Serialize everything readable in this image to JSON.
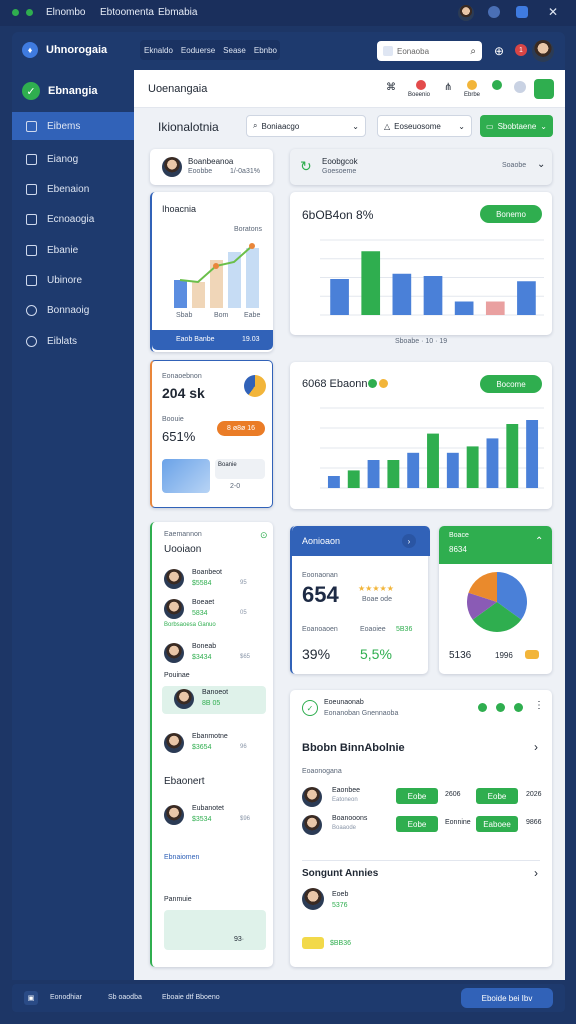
{
  "os_bar": {
    "items": [
      "Elnombo",
      "Ebtoomenta",
      "Ebmabia"
    ]
  },
  "header": {
    "app_name": "Uhnorogaia",
    "nav": [
      "Eknaldo",
      "Eoduerse",
      "Sease",
      "Ebnbo"
    ],
    "search_placeholder": "Eonaoba",
    "notification_count": "1"
  },
  "sidebar": {
    "brand": "Ebnangia",
    "items": [
      {
        "label": "Eibems",
        "icon": "grid-icon",
        "active": true
      },
      {
        "label": "Eianog",
        "icon": "square-icon"
      },
      {
        "label": "Ebenaion",
        "icon": "document-icon"
      },
      {
        "label": "Ecnoaogia",
        "icon": "folder-icon"
      },
      {
        "label": "Ebanie",
        "icon": "edit-icon"
      },
      {
        "label": "Ubinore",
        "icon": "chart-icon"
      },
      {
        "label": "Bonnaoig",
        "icon": "clock-icon"
      },
      {
        "label": "Eiblats",
        "icon": "settings-icon"
      }
    ]
  },
  "top_toolbar": {
    "title": "Uoenangaia",
    "badges": [
      "Boeenio",
      "Ebrbe"
    ]
  },
  "filter_row": {
    "title": "Ikionalotnia",
    "select1": "Boniaacgo",
    "select2": "Eoseuosome",
    "action": "Sbobtaene"
  },
  "user_card": {
    "name": "Boanbeanoa",
    "sub": "Eoobbe",
    "meta": "1/-0a31%"
  },
  "hero_card": {
    "title": "Eoobgcok",
    "sub": "Goesoeme",
    "meta": "Soaobe"
  },
  "mini_chart": {
    "title": "Ihoacnia",
    "legend": "Boratons",
    "footer_label": "Eaob Banbe",
    "footer_value": "19.03",
    "x_labels": [
      "Sbab",
      "Bom",
      "Eabe"
    ]
  },
  "chart1": {
    "title": "6bOB4on 8%",
    "action": "Bonemo",
    "footer": "Sboabe · 10 · 19"
  },
  "chart2": {
    "title": "6068 Ebaonn",
    "action": "Bocome"
  },
  "stat_card": {
    "sub": "Eonaoebnon",
    "value": "204 sk",
    "label": "Boouie",
    "percent": "651%",
    "pill": "8 ø8ø 16",
    "mini_label": "Boanie",
    "mini_value": "2-0"
  },
  "list_panel": {
    "kicker": "Eaemannon",
    "title": "Uooiaon",
    "people": [
      {
        "name": "Boanbeot",
        "value": "$5584",
        "meta": "95"
      },
      {
        "name": "Boeaet",
        "value": "5834",
        "meta": "05"
      },
      {
        "name": "Boneab",
        "value": "$3434",
        "meta": "$65"
      },
      {
        "name": "Banoeot",
        "value": "8B 05",
        "meta": ""
      },
      {
        "name": "Ebanmotne",
        "value": "$3654",
        "meta": "96"
      },
      {
        "name": "Eubanotet",
        "value": "$3534",
        "meta": "$96"
      }
    ],
    "tag": "Borbsaoesa  Ganuo",
    "section": "Pouinae",
    "section2": "Ebaonert",
    "section3": "Ebnaiomen",
    "section4": "Panmuie",
    "footer_value": "93·"
  },
  "blue_card": {
    "title": "Aonioaon",
    "sub": "Eoonaonan",
    "value": "654",
    "rating_label": "Boae ode",
    "col1": "Eoanoaoen",
    "col2": "Eoaoiee",
    "col2_val": "5B36",
    "pct1": "39%",
    "pct2": "5,5%"
  },
  "green_card": {
    "title": "Boace",
    "sub": "8634",
    "value_a": "5136",
    "value_b": "1996"
  },
  "bottom_panel": {
    "header": "Eoeunaonab",
    "header_sub": "Eonanoban Gnennaoba",
    "title": "Bbobn BinnAbolnie",
    "sub": "Eoaonogana",
    "rows": [
      {
        "name": "Eaonbee",
        "sub": "Eatoneon",
        "pill1": "Eobe",
        "col": "2606",
        "pill2": "Eobe",
        "end": "2026"
      },
      {
        "name": "Boanooons",
        "sub": "Boaaode",
        "pill1": "Eobe",
        "col": "Eonnine",
        "pill2": "Eaboee",
        "end": "9866"
      }
    ],
    "section": "Songunt Annies",
    "person": "Eoeb",
    "person_val": "5376",
    "bottom_val": "$BB36"
  },
  "footer": {
    "left": "Eonodhiar",
    "mid": "Sb oaodba",
    "right": "Eboaie dtf Bboeno",
    "button": "Eboide  bei  Ibv"
  }
}
